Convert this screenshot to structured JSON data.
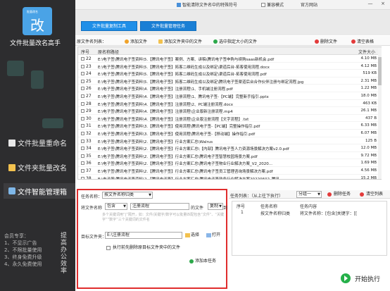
{
  "sidebar": {
    "logo_badge": "批量改名",
    "logo_glyph": "改",
    "app_title": "文件批量改名高手",
    "nav": [
      {
        "label": "文件批量重命名"
      },
      {
        "label": "文件夹批量改名"
      },
      {
        "label": "文件智能管理箱"
      }
    ],
    "member_text": "会员专享：\n1、不显示广告\n2、不限批量使用\n3、终身免费升级\n4、永久免费使用",
    "vertical_text": "提高办公效率"
  },
  "topbar": {
    "title": "智能清除文件名中的特殊符号",
    "checkbox_label": "兼容模式",
    "site_link": "官方网站",
    "min": "—",
    "close": "×"
  },
  "modes": {
    "left": "文件批量复制工具",
    "right": "文件批量管理任务"
  },
  "toolbar": {
    "list_label": "原文件名列表：",
    "add_files": "添加文件",
    "add_folder_files": "添加文件夹中的文件",
    "select_large": "选中指定大小的文件",
    "delete_file": "删除文件",
    "clear_table": "清空表格"
  },
  "table": {
    "headers": {
      "no": "序号",
      "path": "原名称路径",
      "size": "文件大小"
    },
    "rows": [
      {
        "no": "22",
        "path": "E:\\电子签\\腾讯电子签资料\\5.【腾讯电子签】案例、方案、讲稿\\腾讯电子签申购与续购saas新机会.pdf",
        "size": "4.10 MB"
      },
      {
        "no": "23",
        "path": "E:\\电子签\\腾讯电子签资料\\5.【腾讯电子签】拓客二维码生成以及绑定\\渠道后台-拓客使用流程.docx",
        "size": "4.12 MB"
      },
      {
        "no": "24",
        "path": "E:\\电子签\\腾讯电子签资料\\5.【腾讯电子签】拓客二维码生成以及绑定\\渠道后台-拓客使用流程.pdf",
        "size": "519 KB"
      },
      {
        "no": "25",
        "path": "E:\\电子签\\腾讯电子签资料\\5.【腾讯电子签】拓客二维码生成以及绑定\\腾讯电子签渠道后台合作伙伴注册与绑定流程.jpg",
        "size": "2.31 MB"
      },
      {
        "no": "26",
        "path": "E:\\电子签\\腾讯电子签资料\\4.【腾讯电子签】注册流程\\1、手机端注册流程.pdf",
        "size": "1.22 MB"
      },
      {
        "no": "27",
        "path": "E:\\电子签\\腾讯电子签资料\\4.【腾讯电子签】注册流程\\1、腾讯电子签-【PC端】完整新手指引.pptx",
        "size": "18.0 MB"
      },
      {
        "no": "28",
        "path": "E:\\电子签\\腾讯电子签资料\\4.【腾讯电子签】注册流程\\2、PC端注册流程.docx",
        "size": "463 KB"
      },
      {
        "no": "29",
        "path": "E:\\电子签\\腾讯电子签资料\\4.【腾讯电子签】注册流程\\企业版新注册流程.mp4",
        "size": "26.1 MB"
      },
      {
        "no": "30",
        "path": "E:\\电子签\\腾讯电子签资料\\4.【腾讯电子签】注册流程\\企业版注册流程【文字流程】.txt",
        "size": "437 B"
      },
      {
        "no": "31",
        "path": "E:\\电子签\\腾讯电子签资料\\3.【腾讯电子签】使用流程\\腾讯电子签-【PC端】完整操作指引.pdf",
        "size": "6.33 MB"
      },
      {
        "no": "32",
        "path": "E:\\电子签\\腾讯电子签资料\\3.【腾讯电子签】使用流程\\腾讯电子签-【移动端】操作指引.pdf",
        "size": "6.07 MB"
      },
      {
        "no": "33",
        "path": "E:\\电子签\\腾讯电子签资料\\2.【腾讯电子签】行业方案汇总\\Walrus",
        "size": "125 B"
      },
      {
        "no": "34",
        "path": "E:\\电子签\\腾讯电子签资料\\2.【腾讯电子签】行业方案汇总\\【内部】腾讯电子签人力资源场景解决方案v2.0.pdf",
        "size": "12.0 MB"
      },
      {
        "no": "35",
        "path": "E:\\电子签\\腾讯电子签资料\\2.【腾讯电子签】行业方案汇总\\腾讯电子签智慧校园场景方案.pdf",
        "size": "9.72 MB"
      },
      {
        "no": "36",
        "path": "E:\\电子签\\腾讯电子签资料\\2.【腾讯电子签】行业方案汇总\\腾讯电子签物业行业解决方案_V2_2020...",
        "size": "1.69 MB"
      },
      {
        "no": "37",
        "path": "E:\\电子签\\腾讯电子签资料\\2.【腾讯电子签】行业方案汇总\\腾讯电子签员工管理咨询场景解决方案.pdf",
        "size": "4.56 MB"
      },
      {
        "no": "38",
        "path": "E:\\电子签\\腾讯电子签资料\\2.【腾讯电子签】行业方案汇总\\腾讯电子签政务行业解决方案20220602_腾讯...",
        "size": "15.2 MB"
      }
    ]
  },
  "task": {
    "name_label": "任务名称：",
    "name_value": "按文件名称归类",
    "file_name_label": "将文件名称",
    "contains_value": "包含",
    "keyword_value": "注册流程",
    "file_suffix": "的文件",
    "copy_value": "复制",
    "to_label": "到",
    "hint": "多个关键词用“|”隔开，如：文件/关键字/数字可以批量匹配包含“文件”、“关键字”“数字”三个关键词的文件名",
    "target_label": "目标文件夹：",
    "target_value": "E:\\注册流程",
    "choose": "选择",
    "open": "打开",
    "checkbox_label": "执行前先删除原目标文件夹中的文件",
    "add_task": "添加本任务"
  },
  "tasklist": {
    "label": "任务列表：（从上往下执行）",
    "group_value": "分组一",
    "delete_task": "删除任务",
    "clear_list": "清空列表",
    "headers": {
      "no": "序号",
      "name": "任务名称",
      "content": "任务内容"
    },
    "rows": [
      {
        "no": "1",
        "name": "按文件名称归类",
        "content": "将文件名称：[包含]关键字：[["
      }
    ]
  },
  "start_label": "开始执行"
}
